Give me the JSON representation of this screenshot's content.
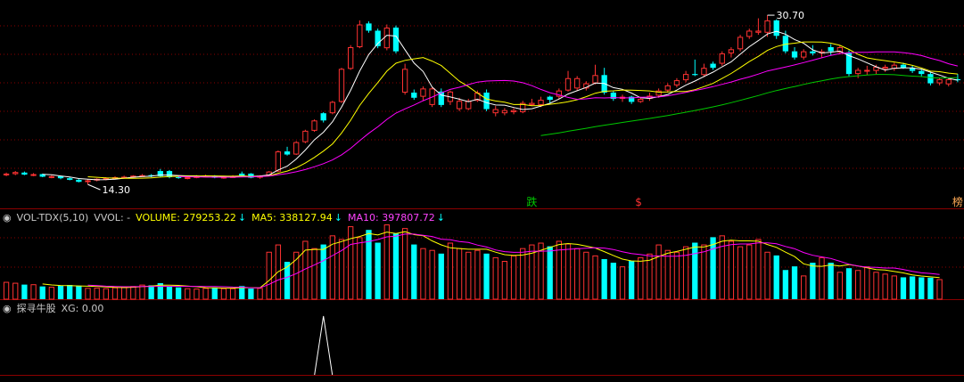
{
  "colors": {
    "bg": "#000000",
    "up": "#ff3232",
    "down": "#00ffff",
    "grid": "#8b0000",
    "ma5": "#ffffff",
    "ma10": "#ffff00",
    "ma20": "#ff00ff",
    "ma60": "#00c800",
    "text": "#c8c8c8",
    "xg": "#ffffff"
  },
  "price_panel": {
    "high_label": "30.70",
    "low_label": "14.30",
    "markers": [
      {
        "text": "跌",
        "color": "#00c800"
      },
      {
        "text": "$",
        "color": "#ff3232"
      },
      {
        "text": "榜",
        "color": "#ffaa55"
      }
    ]
  },
  "vol_panel": {
    "title": "VOL-TDX(5,10)",
    "vvol": "VVOL: -",
    "volume": "VOLUME: 279253.22",
    "ma5": "MA5: 338127.94",
    "ma10": "MA10: 397807.72",
    "arrow": "↓"
  },
  "xg_panel": {
    "title": "探寻牛股",
    "value": "XG: 0.00"
  },
  "chart_data": {
    "type": "candlestick",
    "price_range": [
      12.5,
      32.0
    ],
    "volume_range": [
      0,
      420000
    ],
    "candles": [
      [
        15.2,
        15.45,
        15.1,
        15.35,
        false
      ],
      [
        15.3,
        15.6,
        15.2,
        15.5,
        false
      ],
      [
        15.45,
        15.55,
        15.2,
        15.25,
        true
      ],
      [
        15.25,
        15.4,
        15.1,
        15.3,
        false
      ],
      [
        15.3,
        15.35,
        15.0,
        15.05,
        true
      ],
      [
        15.05,
        15.2,
        14.9,
        15.1,
        false
      ],
      [
        15.1,
        15.15,
        14.8,
        14.9,
        true
      ],
      [
        14.9,
        15.05,
        14.7,
        14.75,
        true
      ],
      [
        14.75,
        14.85,
        14.5,
        14.55,
        true
      ],
      [
        14.55,
        14.8,
        14.3,
        14.7,
        false
      ],
      [
        14.7,
        14.9,
        14.6,
        14.85,
        false
      ],
      [
        14.85,
        15.0,
        14.7,
        14.95,
        false
      ],
      [
        14.95,
        15.1,
        14.85,
        15.0,
        false
      ],
      [
        15.0,
        15.15,
        14.9,
        15.05,
        false
      ],
      [
        15.05,
        15.2,
        14.95,
        15.15,
        false
      ],
      [
        15.15,
        15.3,
        15.05,
        15.2,
        false
      ],
      [
        15.2,
        15.3,
        15.0,
        15.1,
        true
      ],
      [
        15.1,
        15.8,
        15.05,
        15.6,
        true
      ],
      [
        15.6,
        15.7,
        14.9,
        15.0,
        true
      ],
      [
        15.0,
        15.15,
        14.85,
        14.95,
        true
      ],
      [
        14.95,
        15.05,
        14.8,
        15.0,
        false
      ],
      [
        15.0,
        15.2,
        14.9,
        15.1,
        false
      ],
      [
        15.1,
        15.25,
        15.0,
        15.15,
        false
      ],
      [
        15.15,
        15.2,
        14.9,
        14.95,
        true
      ],
      [
        14.95,
        15.1,
        14.85,
        15.05,
        false
      ],
      [
        15.05,
        15.2,
        14.95,
        15.1,
        false
      ],
      [
        15.1,
        15.55,
        15.0,
        15.35,
        true
      ],
      [
        15.35,
        15.4,
        14.9,
        14.95,
        true
      ],
      [
        14.95,
        15.2,
        14.85,
        15.15,
        false
      ],
      [
        15.15,
        15.6,
        15.1,
        15.55,
        false
      ],
      [
        15.55,
        17.6,
        15.5,
        17.5,
        false
      ],
      [
        17.5,
        17.95,
        17.1,
        17.2,
        true
      ],
      [
        17.2,
        18.5,
        17.15,
        18.4,
        false
      ],
      [
        18.4,
        19.6,
        18.3,
        19.5,
        false
      ],
      [
        19.5,
        20.6,
        19.4,
        20.5,
        false
      ],
      [
        20.5,
        21.3,
        20.3,
        21.2,
        true
      ],
      [
        21.2,
        22.4,
        21.1,
        22.3,
        false
      ],
      [
        22.3,
        25.6,
        22.2,
        25.5,
        false
      ],
      [
        25.5,
        27.8,
        25.4,
        27.6,
        false
      ],
      [
        27.6,
        30.2,
        27.5,
        29.8,
        false
      ],
      [
        29.9,
        30.1,
        29.0,
        29.2,
        true
      ],
      [
        29.2,
        29.4,
        27.5,
        27.7,
        true
      ],
      [
        27.5,
        29.8,
        27.3,
        29.5,
        false
      ],
      [
        29.5,
        29.7,
        27.0,
        27.2,
        true
      ],
      [
        25.5,
        26.0,
        23.0,
        23.2,
        false
      ],
      [
        23.2,
        23.5,
        22.5,
        22.7,
        true
      ],
      [
        22.8,
        23.8,
        22.4,
        23.6,
        false
      ],
      [
        23.6,
        23.7,
        21.8,
        22.0,
        false
      ],
      [
        22.0,
        23.6,
        21.8,
        23.3,
        true
      ],
      [
        23.3,
        23.4,
        22.0,
        22.3,
        false
      ],
      [
        22.4,
        22.7,
        21.4,
        21.6,
        false
      ],
      [
        21.6,
        22.6,
        21.5,
        22.4,
        false
      ],
      [
        22.4,
        23.4,
        22.3,
        23.2,
        false
      ],
      [
        23.2,
        23.5,
        21.4,
        21.6,
        true
      ],
      [
        21.6,
        21.9,
        20.9,
        21.2,
        false
      ],
      [
        21.2,
        21.7,
        21.0,
        21.5,
        false
      ],
      [
        21.5,
        21.7,
        21.1,
        21.3,
        false
      ],
      [
        21.3,
        22.4,
        21.2,
        22.2,
        false
      ],
      [
        22.2,
        22.6,
        21.9,
        22.0,
        false
      ],
      [
        22.0,
        22.8,
        21.8,
        22.5,
        false
      ],
      [
        22.5,
        22.9,
        22.2,
        22.8,
        true
      ],
      [
        22.8,
        23.6,
        22.6,
        23.4,
        false
      ],
      [
        23.4,
        25.3,
        23.3,
        24.6,
        false
      ],
      [
        24.6,
        24.8,
        23.4,
        23.6,
        false
      ],
      [
        23.6,
        24.3,
        23.4,
        24.1,
        false
      ],
      [
        24.1,
        25.9,
        24.0,
        24.9,
        false
      ],
      [
        24.9,
        25.6,
        23.0,
        23.2,
        true
      ],
      [
        23.2,
        23.4,
        22.4,
        22.6,
        true
      ],
      [
        22.6,
        23.0,
        22.3,
        22.8,
        false
      ],
      [
        22.8,
        22.9,
        22.1,
        22.3,
        true
      ],
      [
        22.3,
        22.8,
        22.2,
        22.6,
        false
      ],
      [
        22.6,
        23.2,
        22.4,
        22.9,
        false
      ],
      [
        22.9,
        23.6,
        22.7,
        23.4,
        false
      ],
      [
        23.4,
        24.1,
        23.2,
        23.9,
        false
      ],
      [
        23.9,
        24.6,
        23.7,
        24.4,
        false
      ],
      [
        24.4,
        25.3,
        24.2,
        25.0,
        false
      ],
      [
        25.0,
        26.4,
        24.8,
        24.9,
        true
      ],
      [
        24.9,
        26.0,
        24.7,
        25.6,
        false
      ],
      [
        25.6,
        26.2,
        25.4,
        26.0,
        true
      ],
      [
        26.0,
        27.2,
        25.8,
        27.0,
        false
      ],
      [
        27.0,
        27.6,
        26.6,
        27.4,
        false
      ],
      [
        27.4,
        28.8,
        27.2,
        28.6,
        false
      ],
      [
        28.6,
        29.4,
        28.4,
        29.2,
        false
      ],
      [
        29.2,
        30.4,
        28.8,
        29.0,
        false
      ],
      [
        29.0,
        30.7,
        28.6,
        30.2,
        false
      ],
      [
        30.2,
        30.3,
        28.4,
        28.7,
        true
      ],
      [
        28.7,
        29.2,
        27.0,
        27.2,
        true
      ],
      [
        27.2,
        27.6,
        26.4,
        26.6,
        true
      ],
      [
        26.6,
        27.4,
        26.4,
        27.2,
        false
      ],
      [
        27.2,
        27.8,
        26.8,
        27.0,
        true
      ],
      [
        27.0,
        27.4,
        26.6,
        27.2,
        false
      ],
      [
        27.2,
        27.9,
        26.8,
        27.6,
        true
      ],
      [
        27.6,
        27.8,
        26.9,
        27.1,
        false
      ],
      [
        27.1,
        27.3,
        24.8,
        25.0,
        true
      ],
      [
        25.0,
        25.6,
        24.6,
        25.4,
        false
      ],
      [
        25.4,
        25.8,
        24.9,
        25.3,
        false
      ],
      [
        25.3,
        25.9,
        25.0,
        25.7,
        false
      ],
      [
        25.7,
        25.9,
        25.2,
        25.5,
        false
      ],
      [
        25.5,
        26.1,
        25.3,
        25.9,
        false
      ],
      [
        25.9,
        26.1,
        25.5,
        25.6,
        true
      ],
      [
        25.6,
        25.8,
        25.1,
        25.3,
        true
      ],
      [
        25.3,
        25.5,
        24.8,
        25.0,
        true
      ],
      [
        25.0,
        25.2,
        23.9,
        24.1,
        true
      ],
      [
        24.1,
        24.6,
        23.9,
        24.5,
        false
      ],
      [
        24.5,
        24.6,
        23.8,
        24.0,
        false
      ],
      [
        24.5,
        25.0,
        24.2,
        24.4,
        true
      ]
    ],
    "volumes": [
      95000,
      90000,
      80000,
      82000,
      70000,
      68000,
      75000,
      78000,
      74000,
      62000,
      63000,
      60000,
      65000,
      68000,
      72000,
      80000,
      76000,
      88000,
      70000,
      65000,
      60000,
      58000,
      62000,
      64000,
      60000,
      60000,
      72000,
      58000,
      62000,
      260000,
      300000,
      205000,
      260000,
      320000,
      280000,
      300000,
      350000,
      330000,
      400000,
      340000,
      380000,
      310000,
      410000,
      360000,
      390000,
      300000,
      280000,
      270000,
      250000,
      310000,
      280000,
      260000,
      270000,
      250000,
      230000,
      210000,
      240000,
      280000,
      300000,
      310000,
      290000,
      320000,
      305000,
      280000,
      260000,
      240000,
      220000,
      200000,
      180000,
      210000,
      230000,
      250000,
      300000,
      270000,
      260000,
      290000,
      310000,
      300000,
      340000,
      350000,
      320000,
      290000,
      300000,
      330000,
      260000,
      240000,
      160000,
      180000,
      130000,
      200000,
      230000,
      200000,
      150000,
      170000,
      160000,
      180000,
      150000,
      140000,
      130000,
      120000,
      125000,
      120000,
      118000,
      110000
    ],
    "xg_spike_index": 35
  }
}
